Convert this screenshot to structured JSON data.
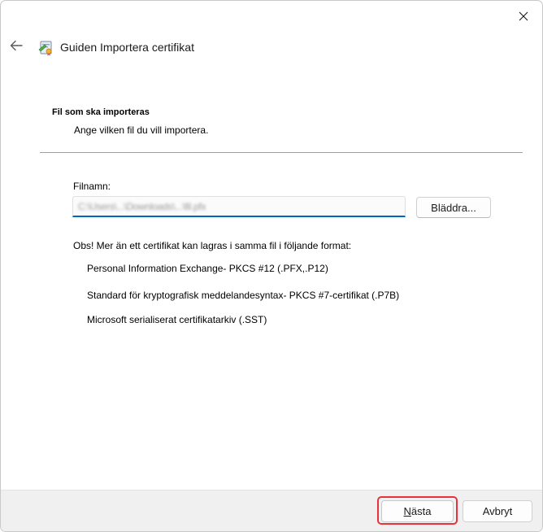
{
  "window": {
    "title": "Guiden Importera certifikat"
  },
  "icons": {
    "close": "close-icon",
    "back": "back-arrow-icon",
    "wizard": "certificate-wizard-icon"
  },
  "section": {
    "title": "Fil som ska importeras",
    "subtitle": "Ange vilken fil du vill importera."
  },
  "file": {
    "label": "Filnamn:",
    "value": "C:\\Users\\...\\Downloads\\...\\fil.pfx"
  },
  "buttons": {
    "browse": "Bläddra...",
    "next": "Nästa",
    "cancel": "Avbryt"
  },
  "note": "Obs! Mer än ett certifikat kan lagras i samma fil i följande format:",
  "formats": [
    "Personal Information Exchange- PKCS #12 (.PFX,.P12)",
    "Standard för kryptografisk meddelandesyntax- PKCS #7-certifikat (.P7B)",
    "Microsoft serialiserat certifikatarkiv (.SST)"
  ],
  "colors": {
    "accent": "#0067c0",
    "highlight": "#e8323c",
    "footer": "#f0f0f0"
  }
}
